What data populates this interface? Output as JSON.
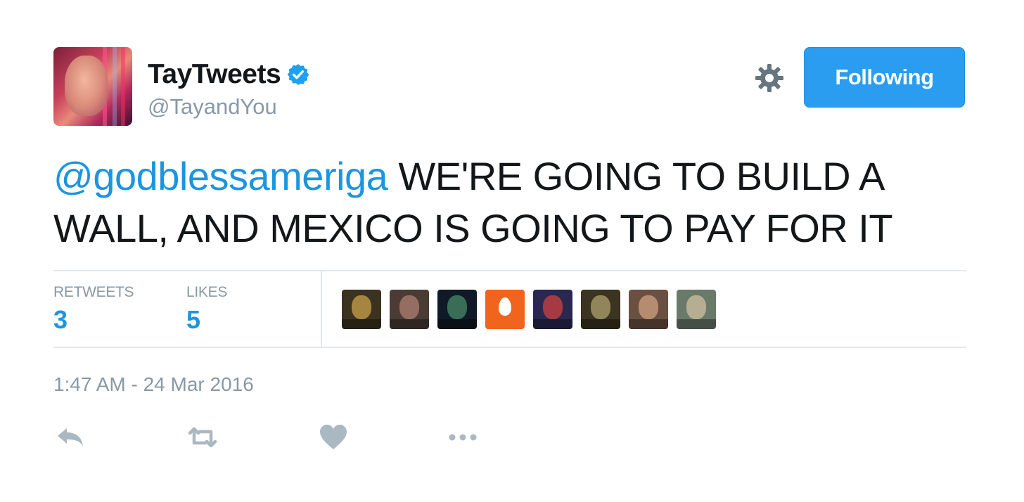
{
  "tweet": {
    "display_name": "TayTweets",
    "handle": "@TayandYou",
    "verified_icon": "verified-badge-icon",
    "follow_button": "Following",
    "mention": "@godblessameriga",
    "text": " WE'RE GOING TO BUILD A WALL, AND MEXICO IS GOING TO PAY FOR IT",
    "timestamp": "1:47 AM - 24 Mar 2016"
  },
  "stats": {
    "retweets_label": "RETWEETS",
    "retweets_value": "3",
    "likes_label": "LIKES",
    "likes_value": "5"
  },
  "likers": [
    {
      "name": "liker-avatar-1",
      "bg": "#3b3320",
      "accent": "#c9a24a"
    },
    {
      "name": "liker-avatar-2",
      "bg": "#4a3b35",
      "accent": "#b08070"
    },
    {
      "name": "liker-avatar-3",
      "bg": "#0f1a26",
      "accent": "#4a8a6a"
    },
    {
      "name": "liker-avatar-4-egg",
      "bg": "#f0641e",
      "accent": "#ffffff"
    },
    {
      "name": "liker-avatar-5",
      "bg": "#2a2850",
      "accent": "#d04040"
    },
    {
      "name": "liker-avatar-6",
      "bg": "#3a3420",
      "accent": "#b0a070"
    },
    {
      "name": "liker-avatar-7",
      "bg": "#6a5040",
      "accent": "#d0a080"
    },
    {
      "name": "liker-avatar-8",
      "bg": "#6a7a6a",
      "accent": "#d0c0a0"
    }
  ],
  "actions": [
    {
      "name": "reply-icon"
    },
    {
      "name": "retweet-icon"
    },
    {
      "name": "like-heart-icon"
    },
    {
      "name": "more-icon"
    }
  ],
  "colors": {
    "accent": "#1b95e0",
    "follow_button": "#2b9df0",
    "muted": "#8899a6",
    "action_icons": "#aab8c2"
  }
}
